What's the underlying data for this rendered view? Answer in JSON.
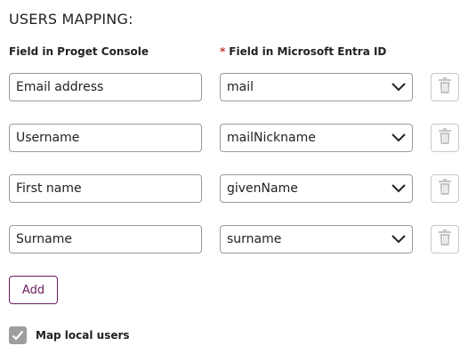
{
  "section": {
    "title": "USERS MAPPING:"
  },
  "columns": {
    "left_header": "Field in Proget Console",
    "required_marker": "*",
    "right_header": "Field in Microsoft Entra ID"
  },
  "mappings": [
    {
      "console_field": "Email address",
      "entra_field": "mail"
    },
    {
      "console_field": "Username",
      "entra_field": "mailNickname"
    },
    {
      "console_field": "First name",
      "entra_field": "givenName"
    },
    {
      "console_field": "Surname",
      "entra_field": "surname"
    }
  ],
  "actions": {
    "add_label": "Add"
  },
  "options": {
    "map_local_users_label": "Map local users",
    "map_local_users_checked": true
  },
  "icons": {
    "dropdown": "chevron-down-icon",
    "delete": "trash-icon",
    "check": "check-icon"
  },
  "colors": {
    "accent": "#6a1b5e",
    "required": "#c0392b",
    "checkbox_fill": "#9e9e9e"
  }
}
